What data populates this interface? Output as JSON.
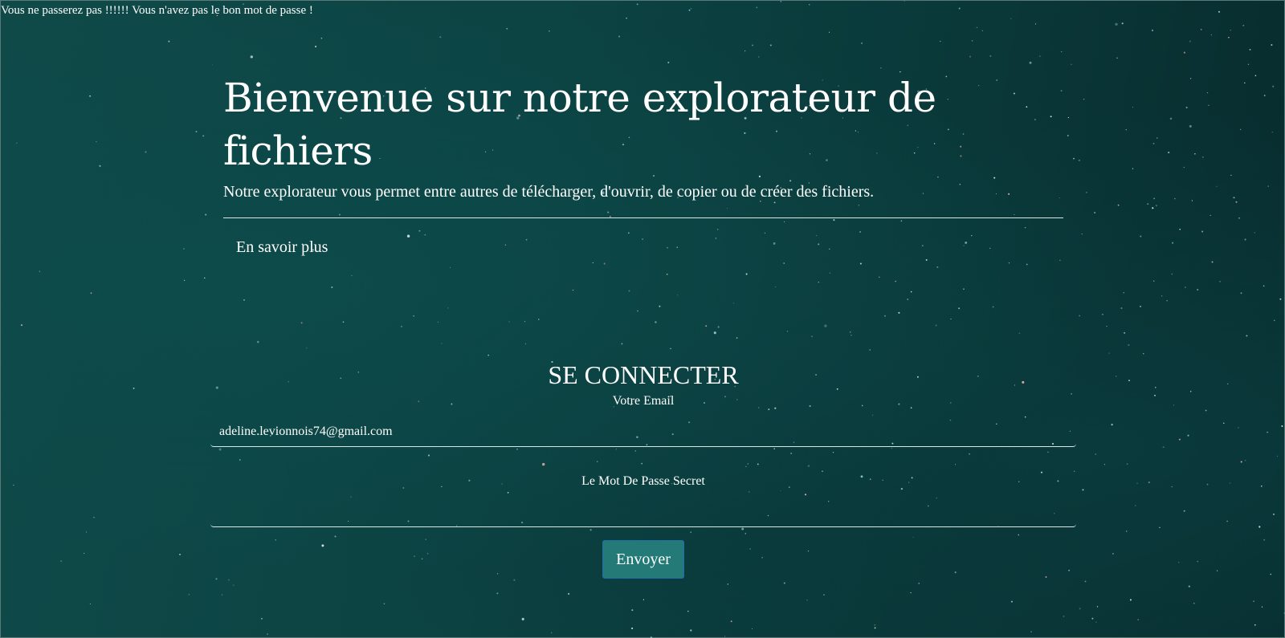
{
  "error_message": "Vous ne passerez pas !!!!!! Vous n'avez pas le bon mot de passe !",
  "hero": {
    "title": "Bienvenue sur notre explorateur de fichiers",
    "subtitle": "Notre explorateur vous permet entre autres de télécharger, d'ouvrir, de copier ou de créer des fichiers.",
    "learn_more_label": "En savoir plus"
  },
  "login": {
    "heading": "SE CONNECTER",
    "email_label": "Votre Email",
    "email_value": "adeline.levionnois74@gmail.com",
    "email_placeholder": "",
    "password_label": "Le Mot De Passe Secret",
    "password_value": "",
    "submit_label": "Envoyer"
  },
  "colors": {
    "background": "#0c4343",
    "button": "#237a77",
    "button_border": "#1e6fb0",
    "text": "#ffffff"
  }
}
